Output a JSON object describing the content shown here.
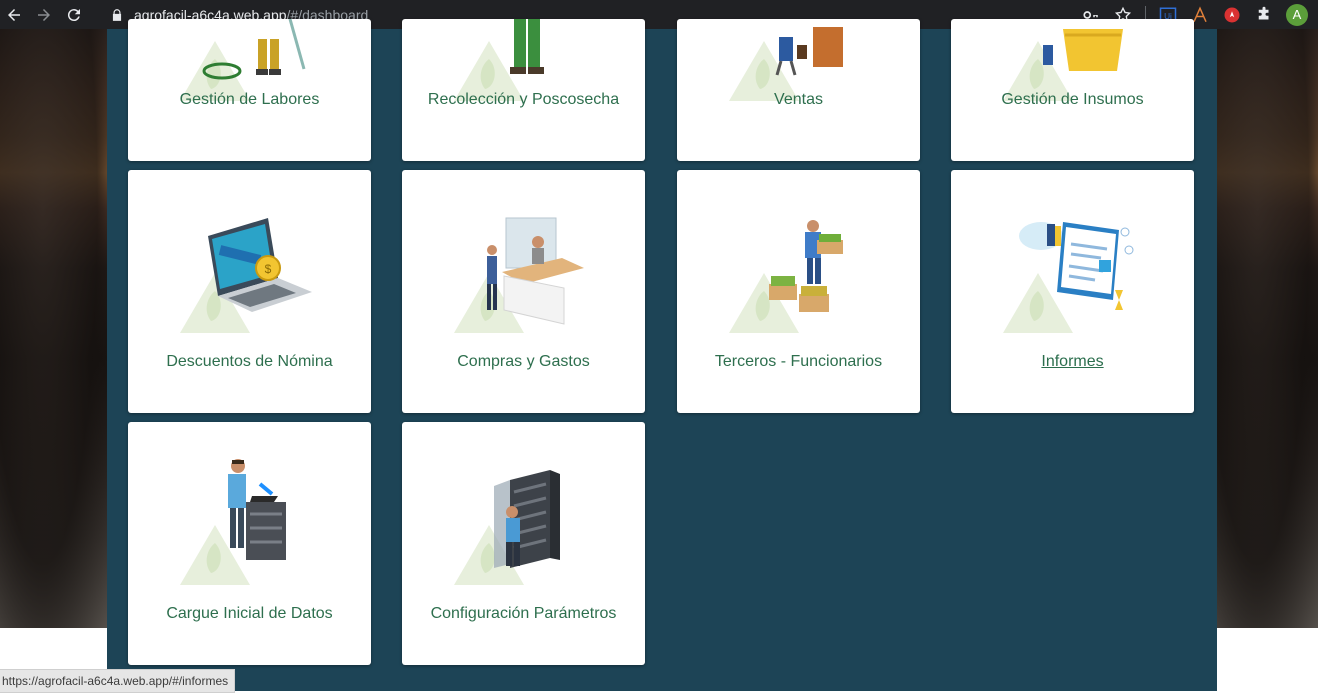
{
  "browser": {
    "url_host": "agrofacil-a6c4a.web.app",
    "url_path": "/#/dashboard",
    "avatar_letter": "A"
  },
  "dashboard": {
    "cards": [
      {
        "label": "Gestión de Labores",
        "icon": "field-worker-icon"
      },
      {
        "label": "Recolección y Poscosecha",
        "icon": "harvest-worker-icon"
      },
      {
        "label": "Ventas",
        "icon": "sales-icon"
      },
      {
        "label": "Gestión de Insumos",
        "icon": "supplies-icon"
      },
      {
        "label": "Descuentos de Nómina",
        "icon": "laptop-payroll-icon"
      },
      {
        "label": "Compras y Gastos",
        "icon": "purchase-counter-icon"
      },
      {
        "label": "Terceros - Funcionarios",
        "icon": "worker-crates-icon"
      },
      {
        "label": "Informes",
        "icon": "reports-dashboard-icon"
      },
      {
        "label": "Cargue Inicial de Datos",
        "icon": "server-rack-user-icon"
      },
      {
        "label": "Configuración Parámetros",
        "icon": "server-cabinet-icon"
      }
    ]
  },
  "status_bar": {
    "text": "https://agrofacil-a6c4a.web.app/#/informes"
  },
  "colors": {
    "panel": "#1d4456",
    "card": "#ffffff",
    "label": "#2e6f4e"
  }
}
